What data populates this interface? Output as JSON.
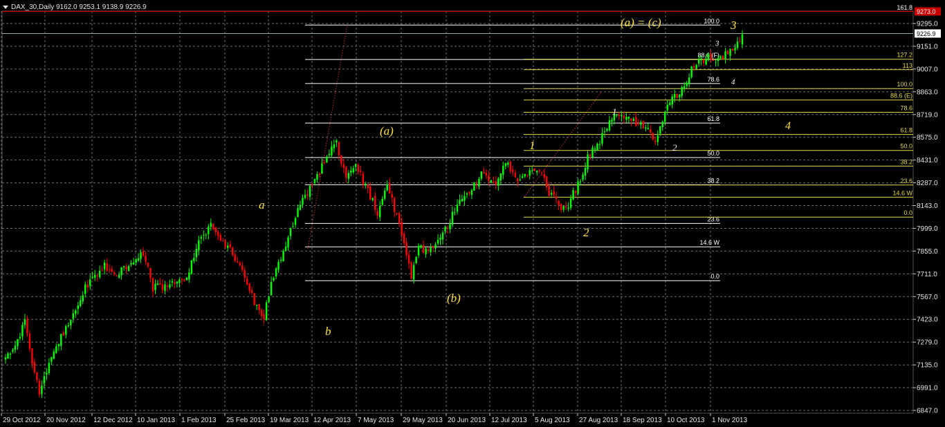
{
  "header": {
    "symbol_line": "DAX_30,Daily  9162.0 9253.1 9138.9 9226.9"
  },
  "colors": {
    "background": "#000000",
    "grid": "#6e6e6e",
    "up": "#00ff00",
    "down": "#ff0000",
    "fib_yellow": "#e6d84a",
    "fib_white": "#ffffff",
    "wave_label": "#ffe33a",
    "price_tag_bg": "#c80000",
    "current_tag_bg": "#ffffff"
  },
  "chart_data": {
    "type": "candlestick",
    "title": "DAX_30,Daily",
    "ohlc_last": {
      "open": 9162.0,
      "high": 9253.1,
      "low": 9138.9,
      "close": 9226.9
    },
    "y_axis": {
      "ylim": [
        6847.0,
        9295.0
      ],
      "ticks": [
        "9295.0",
        "9151.0",
        "9007.0",
        "8863.0",
        "8719.0",
        "8575.0",
        "8431.0",
        "8287.0",
        "8143.0",
        "7999.0",
        "7855.0",
        "7711.0",
        "7567.0",
        "7423.0",
        "7279.0",
        "7135.0",
        "6991.0",
        "6847.0"
      ],
      "current_price_label": "9226.9",
      "marked_price_label": "9273.0"
    },
    "x_axis": {
      "ticks": [
        "29 Oct 2012",
        "20 Nov 2012",
        "12 Dec 2012",
        "10 Jan 2013",
        "1 Feb 2013",
        "25 Feb 2013",
        "19 Mar 2013",
        "12 Apr 2013",
        "7 May 2013",
        "29 May 2013",
        "20 Jun 2013",
        "12 Jul 2013",
        "5 Aug 2013",
        "27 Aug 2013",
        "18 Sep 2013",
        "10 Oct 2013",
        "1 Nov 2013"
      ]
    },
    "grid": true,
    "anchors": [
      {
        "d": 0,
        "c": 7190
      },
      {
        "d": 5,
        "c": 7300
      },
      {
        "d": 8,
        "c": 7420
      },
      {
        "d": 12,
        "c": 7080
      },
      {
        "d": 14,
        "c": 6950
      },
      {
        "d": 18,
        "c": 7150
      },
      {
        "d": 26,
        "c": 7400
      },
      {
        "d": 33,
        "c": 7630
      },
      {
        "d": 41,
        "c": 7770
      },
      {
        "d": 46,
        "c": 7710
      },
      {
        "d": 52,
        "c": 7760
      },
      {
        "d": 57,
        "c": 7850
      },
      {
        "d": 61,
        "c": 7620
      },
      {
        "d": 68,
        "c": 7640
      },
      {
        "d": 75,
        "c": 7700
      },
      {
        "d": 80,
        "c": 7900
      },
      {
        "d": 85,
        "c": 8040
      },
      {
        "d": 90,
        "c": 7920
      },
      {
        "d": 96,
        "c": 7800
      },
      {
        "d": 99,
        "c": 7680
      },
      {
        "d": 104,
        "c": 7500
      },
      {
        "d": 107,
        "c": 7430
      },
      {
        "d": 110,
        "c": 7650
      },
      {
        "d": 116,
        "c": 7900
      },
      {
        "d": 122,
        "c": 8150
      },
      {
        "d": 128,
        "c": 8300
      },
      {
        "d": 133,
        "c": 8450
      },
      {
        "d": 137,
        "c": 8530
      },
      {
        "d": 141,
        "c": 8300
      },
      {
        "d": 145,
        "c": 8400
      },
      {
        "d": 150,
        "c": 8230
      },
      {
        "d": 154,
        "c": 8100
      },
      {
        "d": 158,
        "c": 8300
      },
      {
        "d": 164,
        "c": 7950
      },
      {
        "d": 168,
        "c": 7700
      },
      {
        "d": 171,
        "c": 7880
      },
      {
        "d": 175,
        "c": 7850
      },
      {
        "d": 179,
        "c": 7930
      },
      {
        "d": 183,
        "c": 8020
      },
      {
        "d": 188,
        "c": 8180
      },
      {
        "d": 194,
        "c": 8280
      },
      {
        "d": 198,
        "c": 8350
      },
      {
        "d": 203,
        "c": 8260
      },
      {
        "d": 207,
        "c": 8420
      },
      {
        "d": 212,
        "c": 8290
      },
      {
        "d": 217,
        "c": 8380
      },
      {
        "d": 222,
        "c": 8350
      },
      {
        "d": 225,
        "c": 8230
      },
      {
        "d": 229,
        "c": 8150
      },
      {
        "d": 232,
        "c": 8110
      },
      {
        "d": 235,
        "c": 8220
      },
      {
        "d": 238,
        "c": 8300
      },
      {
        "d": 241,
        "c": 8460
      },
      {
        "d": 245,
        "c": 8510
      },
      {
        "d": 249,
        "c": 8650
      },
      {
        "d": 252,
        "c": 8710
      },
      {
        "d": 256,
        "c": 8690
      },
      {
        "d": 260,
        "c": 8680
      },
      {
        "d": 263,
        "c": 8650
      },
      {
        "d": 266,
        "c": 8610
      },
      {
        "d": 269,
        "c": 8520
      },
      {
        "d": 272,
        "c": 8700
      },
      {
        "d": 276,
        "c": 8810
      },
      {
        "d": 280,
        "c": 8890
      },
      {
        "d": 284,
        "c": 9000
      },
      {
        "d": 288,
        "c": 9060
      },
      {
        "d": 291,
        "c": 9090
      },
      {
        "d": 294,
        "c": 9040
      },
      {
        "d": 298,
        "c": 9110
      },
      {
        "d": 303,
        "c": 9170
      },
      {
        "d": 305,
        "c": 9227
      }
    ]
  },
  "fib_sets": {
    "left_white": {
      "color": "white",
      "levels": [
        {
          "label": "100.0",
          "value": 9285
        },
        {
          "label": "88.6 (F)",
          "value": 9067
        },
        {
          "label": "78.6",
          "value": 8915
        },
        {
          "label": "61.8",
          "value": 8665
        },
        {
          "label": "50.0",
          "value": 8447
        },
        {
          "label": "38.2",
          "value": 8275
        },
        {
          "label": "23.6",
          "value": 8030
        },
        {
          "label": "14.6 W",
          "value": 7882
        },
        {
          "label": "0.0",
          "value": 7668
        }
      ]
    },
    "right_yellow": {
      "color": "yellow",
      "levels": [
        {
          "label": "161.8",
          "value": 9380
        },
        {
          "label": "127.2",
          "value": 9069
        },
        {
          "label": "113",
          "value": 9003
        },
        {
          "label": "100.0",
          "value": 8883
        },
        {
          "label": "88.6 (E)",
          "value": 8811
        },
        {
          "label": "78.6",
          "value": 8733
        },
        {
          "label": "61.8",
          "value": 8593
        },
        {
          "label": "50.0",
          "value": 8492
        },
        {
          "label": "38.2",
          "value": 8393
        },
        {
          "label": "23.6",
          "value": 8273
        },
        {
          "label": "14.6 W",
          "value": 8196
        },
        {
          "label": "0.0",
          "value": 8070
        }
      ]
    }
  },
  "wave_labels": [
    {
      "text": "a",
      "style": "yellow"
    },
    {
      "text": "b",
      "style": "yellow"
    },
    {
      "text": "(a)",
      "style": "yellow"
    },
    {
      "text": "(b)",
      "style": "yellow"
    },
    {
      "text": "(a) = (c)",
      "style": "yellow"
    },
    {
      "text": "1",
      "style": "yellow"
    },
    {
      "text": "2",
      "style": "yellow"
    },
    {
      "text": "3",
      "style": "yellow"
    },
    {
      "text": "4",
      "style": "yellow"
    },
    {
      "text": "1",
      "style": "white"
    },
    {
      "text": "2",
      "style": "white"
    },
    {
      "text": "3",
      "style": "white"
    },
    {
      "text": "4",
      "style": "white"
    }
  ]
}
